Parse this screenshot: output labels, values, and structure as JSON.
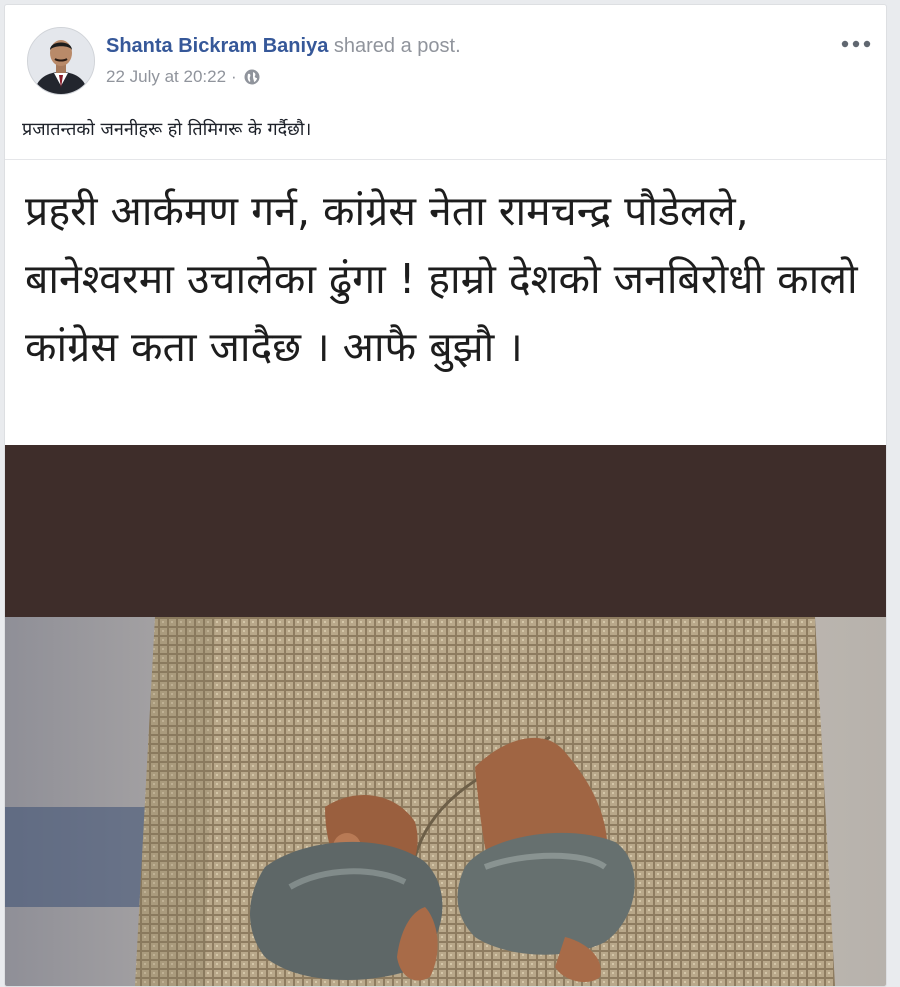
{
  "post": {
    "author_name": "Shanta Bickram Baniya",
    "action_text": " shared a post.",
    "timestamp": "22 July at 20:22",
    "separator": "·",
    "privacy_icon": "globe-icon",
    "more_icon": "more-options-icon",
    "caption": "प्रजातन्तको जननीहरू हो तिमिगरू के गर्दैछौ।"
  },
  "shared_post": {
    "text": "प्रहरी आर्कमण गर्न, कांग्रेस नेता रामचन्द्र पौडेलले, बानेश्वरमा उचालेका ढुंगा ! हाम्रो देशको जनबिरोधी कालो कांग्रेस कता जादैछ । आफै बुझौ ।",
    "image": "hands-holding-stones-photo"
  },
  "colors": {
    "link": "#365899",
    "meta": "#90949c",
    "band": "#3e2d2a",
    "page_bg": "#e9ebee"
  }
}
